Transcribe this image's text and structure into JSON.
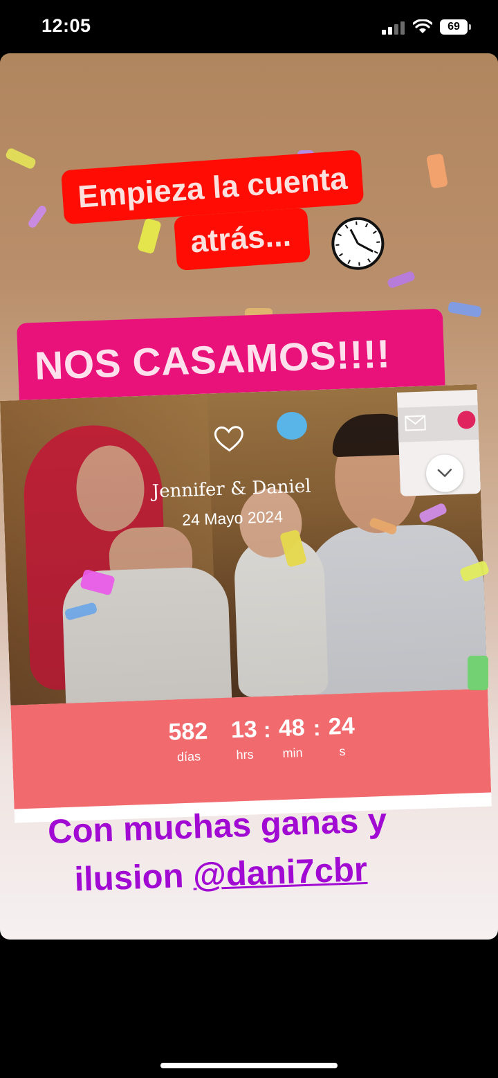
{
  "status_bar": {
    "time": "12:05",
    "battery": "69"
  },
  "story": {
    "sticker_top_line1": "Empieza la cuenta",
    "sticker_top_line2": "atrás...",
    "sticker_main": "NOS CASAMOS!!!!",
    "caption_line1": "Con muchas ganas y",
    "caption_line2_prefix": "ilusion ",
    "caption_mention": "@dani7cbr"
  },
  "wedding_card": {
    "names": "Jennifer & Daniel",
    "date": "24 Mayo 2024",
    "countdown": [
      {
        "value": "582",
        "unit": "días"
      },
      {
        "value": "13",
        "unit": "hrs"
      },
      {
        "value": "48",
        "unit": "min"
      },
      {
        "value": "24",
        "unit": "s"
      }
    ]
  },
  "icons": [
    "clock-icon",
    "heart-icon",
    "mail-icon",
    "chevron-down-icon",
    "wifi-icon",
    "signal-icon",
    "battery-icon"
  ],
  "colors": {
    "red_sticker": "#ff0d05",
    "pink_sticker": "#e8127a",
    "countdown_band": "#f06a6e",
    "caption": "#a10ad2"
  }
}
